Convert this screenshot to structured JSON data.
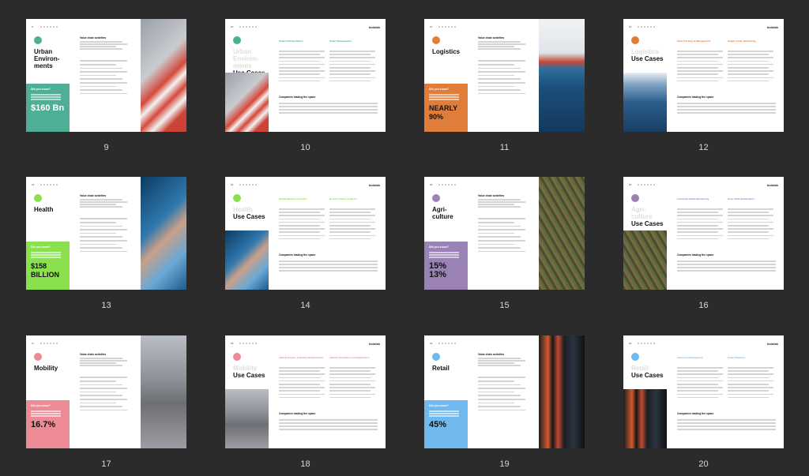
{
  "pages": [
    {
      "num": "9",
      "pg": "9",
      "type": "intro",
      "title": "Urban Environments",
      "title_lines": [
        "Urban",
        "Environ-",
        "ments"
      ],
      "color": "#4fae96",
      "vca": "Value chain activities",
      "dyk": "Did you know?",
      "big": "$160 Bn",
      "photo": "architecture-photo"
    },
    {
      "num": "10",
      "pg": "10",
      "type": "usecase",
      "title_lines": [
        "Urban",
        "Environ-",
        "ments"
      ],
      "uc": "Use Cases",
      "color": "#4fae96",
      "h1": "Smart Parking Meters",
      "h2": "Smart Wastebasket",
      "cl": "Companies leading the space"
    },
    {
      "num": "11",
      "pg": "11",
      "type": "intro",
      "title": "Logistics",
      "title_lines": [
        "Logistics"
      ],
      "color": "#e07d3a",
      "vca": "Value chain activities",
      "dyk": "Did you know?",
      "big": "NEARLY 90%",
      "photo": "port-photo"
    },
    {
      "num": "12",
      "pg": "12",
      "type": "usecase",
      "title_lines": [
        "Logistics"
      ],
      "uc": "Use Cases",
      "color": "#e07d3a",
      "h1": "Fleet Tracking & Management",
      "h2": "Supply Chain Monitoring",
      "cl": "Companies leading the space"
    },
    {
      "num": "13",
      "pg": "13",
      "type": "intro",
      "title": "Health",
      "title_lines": [
        "Health"
      ],
      "color": "#8be04e",
      "vca": "Value chain activities",
      "dyk": "Did you know?",
      "big": "$158 BILLION",
      "photo": "smartwatch-photo"
    },
    {
      "num": "14",
      "pg": "14",
      "type": "usecase",
      "title_lines": [
        "Health"
      ],
      "uc": "Use Cases",
      "color": "#8be04e",
      "h1": "Digital Medical Assistant",
      "h2": "Remote Patient Analysis",
      "cl": "Companies leading the space"
    },
    {
      "num": "15",
      "pg": "15",
      "type": "intro",
      "title": "Agriculture",
      "title_lines": [
        "Agri-",
        "culture"
      ],
      "color": "#9b82b6",
      "vca": "Value chain activities",
      "dyk": "Did you know?",
      "big": "15% 13%",
      "photo": "field-photo"
    },
    {
      "num": "16",
      "pg": "16",
      "type": "usecase",
      "title_lines": [
        "Agri-",
        "culture"
      ],
      "uc": "Use Cases",
      "color": "#9b82b6",
      "h1": "Livestock Health Monitoring",
      "h2": "Crop Yield Optimization",
      "cl": "Companies leading the space"
    },
    {
      "num": "17",
      "pg": "17",
      "type": "intro",
      "title": "Mobility",
      "title_lines": [
        "Mobility"
      ],
      "color": "#ec8a96",
      "vca": "Value chain activities",
      "dyk": "Did you know?",
      "big": "16.7%",
      "photo": "street-photo"
    },
    {
      "num": "18",
      "pg": "18",
      "type": "usecase",
      "title_lines": [
        "Mobility"
      ],
      "uc": "Use Cases",
      "color": "#ec8a96",
      "h1": "Vehicle Repairs & Battery Replacement",
      "h2": "Vehicle Telematics and Diagnostics",
      "cl": "Companies leading the space"
    },
    {
      "num": "19",
      "pg": "19",
      "type": "intro",
      "title": "Retail",
      "title_lines": [
        "Retail"
      ],
      "color": "#6fb9ee",
      "vca": "Value chain activities",
      "dyk": "Did you know?",
      "big": "45%",
      "photo": "clothing-photo"
    },
    {
      "num": "20",
      "pg": "20",
      "type": "usecase",
      "title_lines": [
        "Retail"
      ],
      "uc": "Use Cases",
      "color": "#6fb9ee",
      "h1": "Inventory Management",
      "h2": "Smart Payment",
      "cl": "Companies leading the space"
    }
  ],
  "logo": "hololab"
}
